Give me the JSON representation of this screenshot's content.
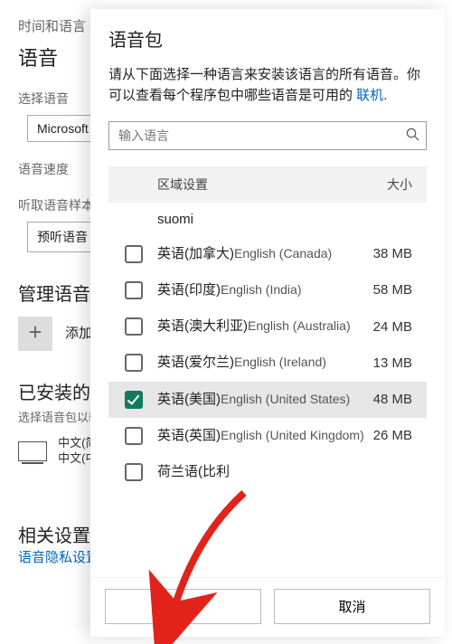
{
  "bg": {
    "breadcrumb": "时间和语言  ›  语音",
    "title": "语音",
    "choose_lbl": "选择语音",
    "choose_val": "Microsoft Hu",
    "speed_lbl": "语音速度",
    "sample_lbl": "听取语音样本",
    "sample_btn": "预听语音",
    "manage_title": "管理语音",
    "add_btn": "添加语",
    "installed_title": "已安装的语",
    "installed_sub": "选择语音包以转",
    "zh1": "中文(简",
    "zh2": "中文(中",
    "related_title": "相关设置",
    "privacy_link": "语音隐私设置"
  },
  "dlg": {
    "title": "语音包",
    "desc_a": "请从下面选择一种语言来安装该语言的所有语音。你可以查看每个程序包中哪些语音是可用的 ",
    "desc_link": "联机",
    "desc_b": ".",
    "search_ph": "输入语言",
    "col_region": "区域设置",
    "col_size": "大小",
    "items": [
      {
        "name": "suomi",
        "eng": "",
        "size": "",
        "single": true,
        "checked": false
      },
      {
        "name": "英语(加拿大)",
        "eng": "English (Canada)",
        "size": "38 MB",
        "checked": false
      },
      {
        "name": "英语(印度)",
        "eng": "English (India)",
        "size": "58 MB",
        "checked": false
      },
      {
        "name": "英语(澳大利亚)",
        "eng": "English (Australia)",
        "size": "24 MB",
        "checked": false
      },
      {
        "name": "英语(爱尔兰)",
        "eng": "English (Ireland)",
        "size": "13 MB",
        "checked": false
      },
      {
        "name": "英语(美国)",
        "eng": "English (United States)",
        "size": "48 MB",
        "checked": true
      },
      {
        "name": "英语(英国)",
        "eng": "English (United Kingdom)",
        "size": "26 MB",
        "checked": false
      },
      {
        "name": "荷兰语(比利",
        "eng": "",
        "size": "",
        "single": false,
        "checked": false
      }
    ],
    "btn_add": "添加",
    "btn_cancel": "取消"
  },
  "colors": {
    "accent": "#107c5c",
    "link": "#0067c0",
    "arrow": "#e2231a"
  }
}
